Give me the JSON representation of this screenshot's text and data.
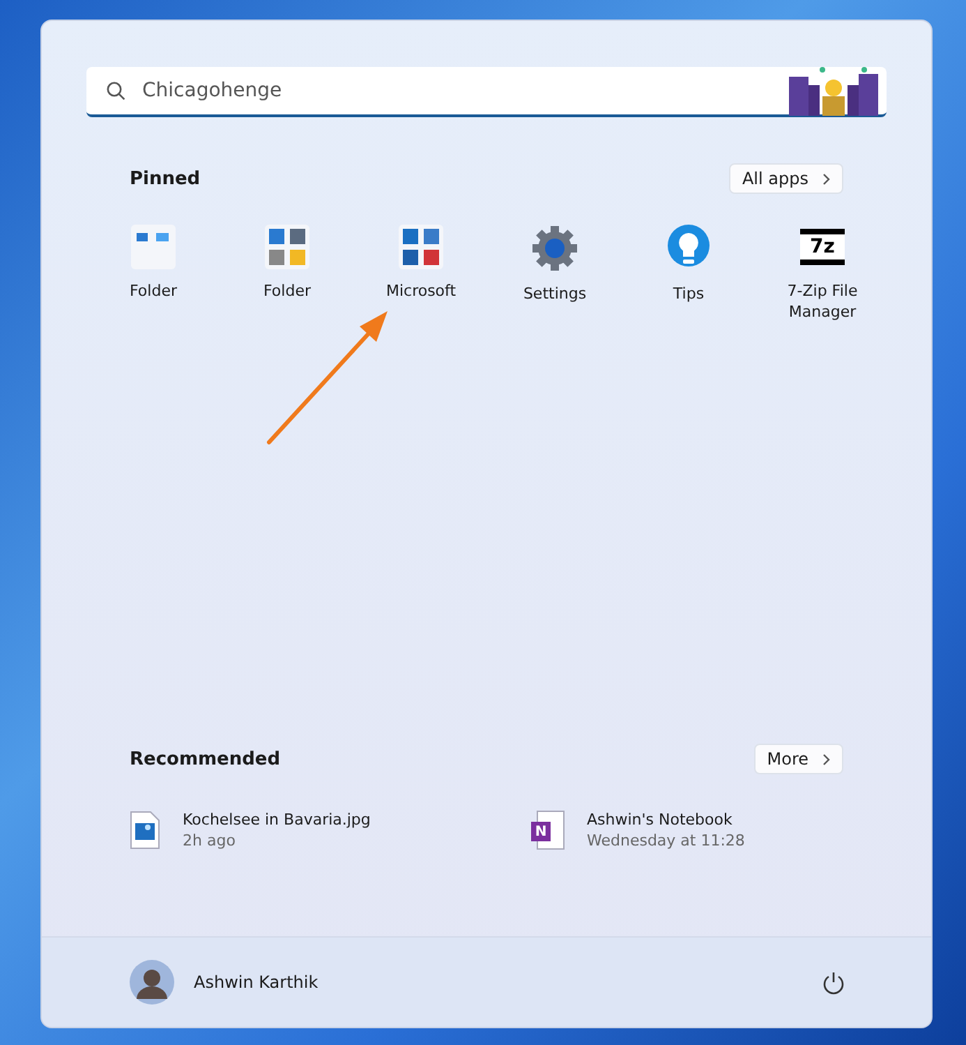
{
  "search": {
    "value": "Chicagohenge"
  },
  "pinned": {
    "title": "Pinned",
    "button": "All apps",
    "apps": [
      {
        "label": "Folder",
        "kind": "folder-a"
      },
      {
        "label": "Folder",
        "kind": "folder-b"
      },
      {
        "label": "Microsoft",
        "kind": "folder-c"
      },
      {
        "label": "Settings",
        "kind": "gear"
      },
      {
        "label": "Tips",
        "kind": "bulb"
      },
      {
        "label": "7-Zip File Manager",
        "kind": "zip",
        "icon_text": "7z"
      }
    ]
  },
  "recommended": {
    "title": "Recommended",
    "button": "More",
    "items": [
      {
        "name": "Kochelsee in Bavaria.jpg",
        "time": "2h ago",
        "kind": "image"
      },
      {
        "name": "Ashwin's Notebook",
        "time": "Wednesday at 11:28",
        "kind": "onenote",
        "icon_text": "N"
      }
    ]
  },
  "footer": {
    "user": "Ashwin Karthik"
  }
}
